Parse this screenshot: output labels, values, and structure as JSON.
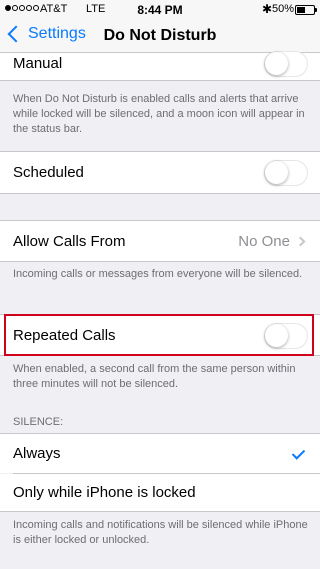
{
  "status_bar": {
    "carrier": "AT&T",
    "network": "LTE",
    "time": "8:44 PM",
    "battery": "50%",
    "battery_fill": 0.5,
    "signal_strength": 1,
    "bluetooth_icon": "bluetooth-icon"
  },
  "nav": {
    "back_label": "Settings",
    "title": "Do Not Disturb"
  },
  "settings": {
    "manual": {
      "label": "Manual",
      "enabled": false
    },
    "manual_footer": "When Do Not Disturb is enabled calls and alerts that arrive while locked will be silenced, and a moon icon will appear in the status bar.",
    "scheduled": {
      "label": "Scheduled",
      "enabled": false
    },
    "allow_calls": {
      "label": "Allow Calls From",
      "value": "No One"
    },
    "allow_calls_footer": "Incoming calls or messages from everyone will be silenced.",
    "repeated_calls": {
      "label": "Repeated Calls",
      "enabled": false
    },
    "repeated_calls_footer": "When enabled, a second call from the same person within three minutes will not be silenced.",
    "silence_header": "SILENCE:",
    "silence_options": [
      {
        "label": "Always",
        "selected": true
      },
      {
        "label": "Only while iPhone is locked",
        "selected": false
      }
    ],
    "silence_footer": "Incoming calls and notifications will be silenced while iPhone is either locked or unlocked."
  },
  "colors": {
    "accent": "#0a7aff",
    "highlight_box": "#d0021b",
    "background": "#efeff4"
  }
}
